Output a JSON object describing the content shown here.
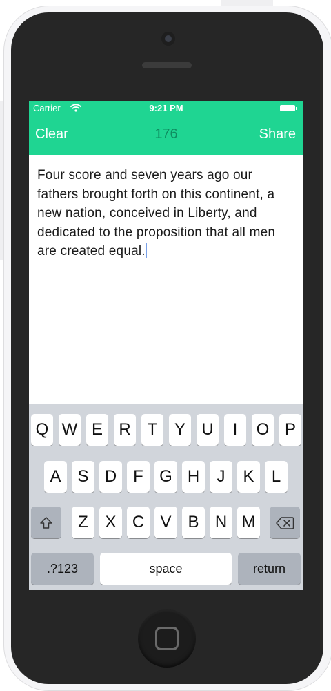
{
  "status_bar": {
    "carrier": "Carrier",
    "time": "9:21 PM"
  },
  "nav": {
    "left_label": "Clear",
    "count": "176",
    "right_label": "Share"
  },
  "editor": {
    "text": "Four score and seven years ago our fathers brought forth on this continent, a new nation, conceived in Liberty, and dedicated to the proposition that all men are created equal."
  },
  "keyboard": {
    "row1": [
      "Q",
      "W",
      "E",
      "R",
      "T",
      "Y",
      "U",
      "I",
      "O",
      "P"
    ],
    "row2": [
      "A",
      "S",
      "D",
      "F",
      "G",
      "H",
      "J",
      "K",
      "L"
    ],
    "row3": [
      "Z",
      "X",
      "C",
      "V",
      "B",
      "N",
      "M"
    ],
    "numbers_label": ".?123",
    "space_label": "space",
    "return_label": "return"
  },
  "icons": {
    "wifi": "wifi-icon",
    "battery": "battery-icon",
    "shift": "shift-icon",
    "delete": "delete-icon",
    "home": "home-button-icon"
  },
  "colors": {
    "accent": "#1fd592",
    "counter": "#0e8d60",
    "keyboard_bg": "#d1d5db"
  }
}
